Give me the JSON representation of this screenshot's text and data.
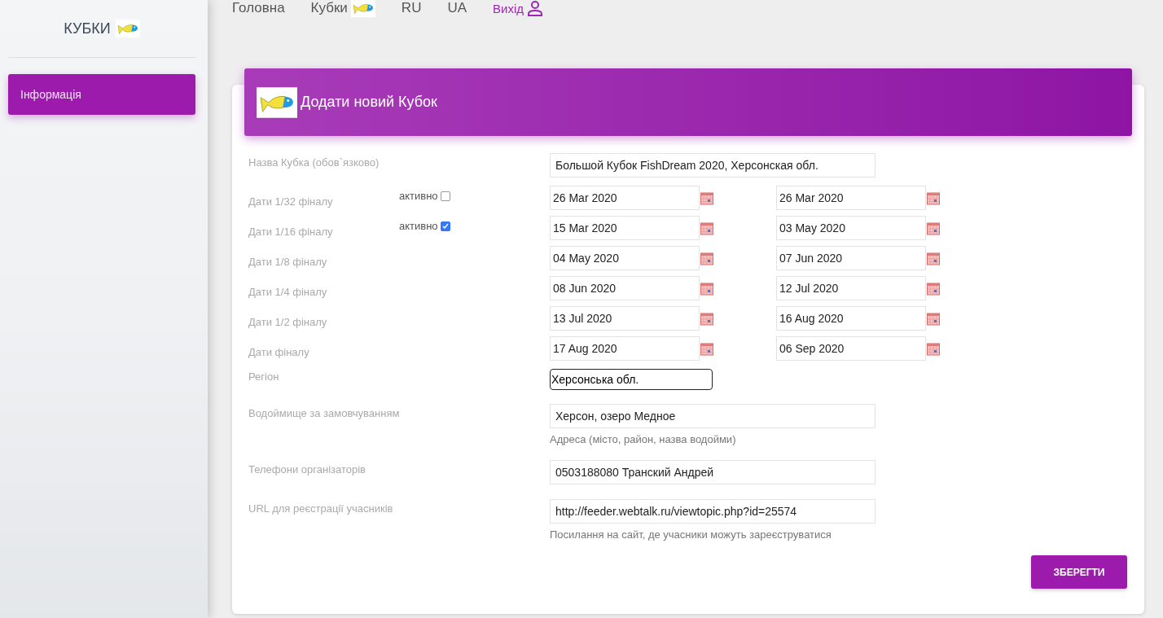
{
  "sidebar": {
    "title": "КУБКИ",
    "items": [
      {
        "label": "Інформація",
        "selected": true
      }
    ]
  },
  "nav": [
    {
      "label": "Головна",
      "kind": "link"
    },
    {
      "label": "Кубки",
      "kind": "logo"
    },
    {
      "label": "RU",
      "kind": "link"
    },
    {
      "label": "UA",
      "kind": "link"
    },
    {
      "label": "Вихід",
      "kind": "user"
    }
  ],
  "card": {
    "title": "Додати новий Кубок",
    "name_field": {
      "label": "Назва Кубка (обов`язково)",
      "value": "Большой Кубок FishDream 2020, Херсонская обл."
    },
    "date_rows": [
      {
        "label": "Дати 1/32 фіналу",
        "toggle": {
          "label": "активно",
          "checked": false
        },
        "start": "26 Mar 2020",
        "end": "26 Mar 2020"
      },
      {
        "label": "Дати 1/16 фіналу",
        "toggle": {
          "label": "активно",
          "checked": true
        },
        "start": "15 Mar 2020",
        "end": "03 May 2020"
      },
      {
        "label": "Дати 1/8 фіналу",
        "start": "04 May 2020",
        "end": "07 Jun 2020"
      },
      {
        "label": "Дати 1/4 фіналу",
        "start": "08 Jun 2020",
        "end": "12 Jul 2020"
      },
      {
        "label": "Дати 1/2 фіналу",
        "start": "13 Jul 2020",
        "end": "16 Aug 2020"
      },
      {
        "label": "Дати фіналу",
        "start": "17 Aug 2020",
        "end": "06 Sep 2020"
      }
    ],
    "region": {
      "label": "Регіон",
      "value": "Херсонська обл."
    },
    "fields": [
      {
        "label": "Водоймище за замовчуванням",
        "value": "Херсон, озеро Медное",
        "hint": "Адреса (місто, район, назва водойми)"
      },
      {
        "label": "Телефони організаторів",
        "value": "0503188080 Транский Андрей"
      },
      {
        "label": "URL для реєстрації учасників",
        "value": "http://feeder.webtalk.ru/viewtopic.php?id=25574",
        "hint": "Посилання на сайт, де учасники можуть зареєструватися"
      }
    ],
    "save_button": "ЗБЕРЕГТИ"
  }
}
